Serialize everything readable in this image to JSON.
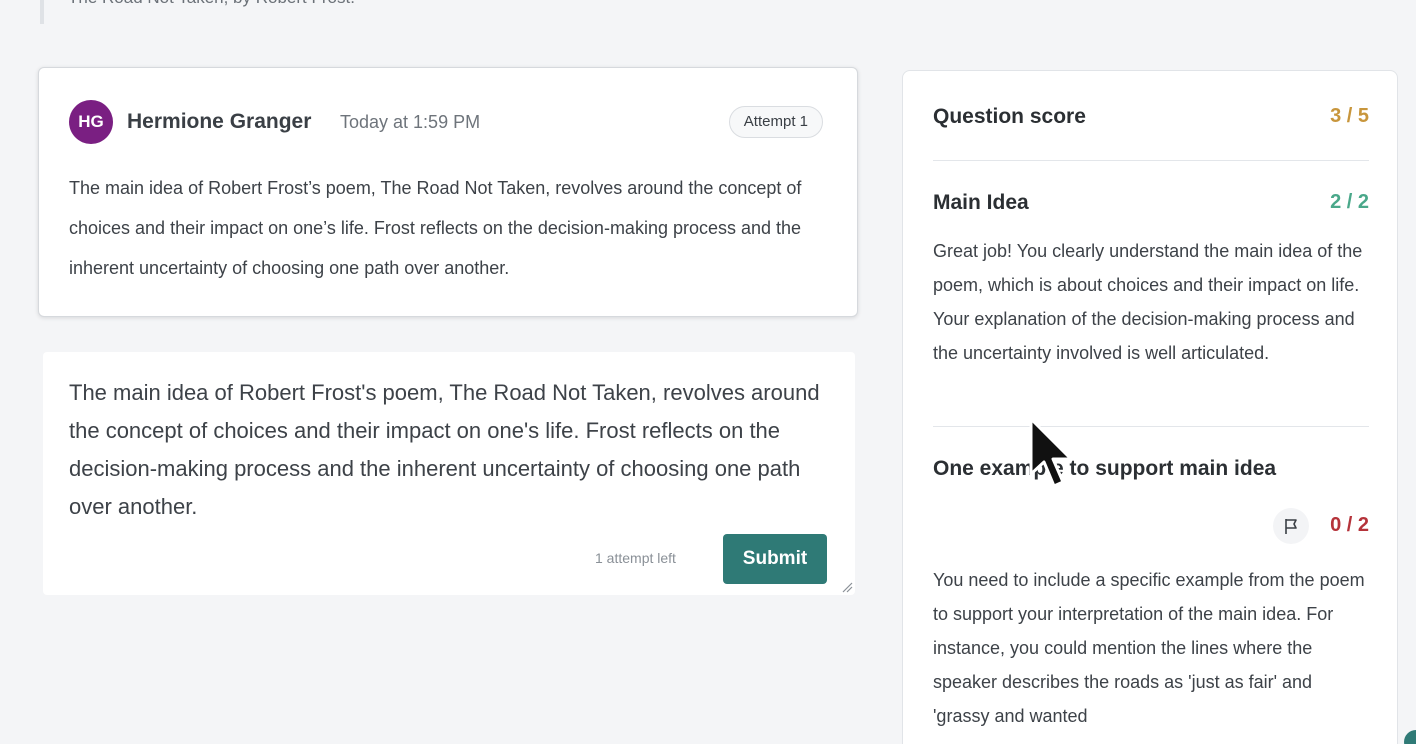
{
  "source": {
    "text": "The Road Not Taken, by Robert Frost."
  },
  "submission": {
    "avatar_initials": "HG",
    "author": "Hermione Granger",
    "timestamp": "Today at 1:59 PM",
    "attempt_badge": "Attempt 1",
    "body": "The main idea of Robert Frost’s poem, The Road Not Taken, revolves around the concept of choices and their impact on one’s life. Frost reflects on the decision-making process and the inherent uncertainty of choosing one path over another."
  },
  "answer": {
    "text": "The main idea of Robert Frost's poem, The Road Not Taken, revolves around the concept of choices and their impact on one's life. Frost reflects on the decision-making process and the inherent uncertainty of choosing one path over another.",
    "attempts_left": "1 attempt left",
    "submit_label": "Submit"
  },
  "score_panel": {
    "question_score_label": "Question score",
    "question_score": "3 / 5",
    "criteria": [
      {
        "title": "Main Idea",
        "score": "2 / 2",
        "feedback": "Great job! You clearly understand the main idea of the poem, which is about choices and their impact on life. Your explanation of the decision-making process and the uncertainty involved is well articulated."
      },
      {
        "title": "One example to support main idea",
        "score": "0 / 2",
        "feedback": "You need to include a specific example from the poem to support your interpretation of the main idea. For instance, you could mention the lines where the speaker describes the roads as 'just as fair' and 'grassy and wanted"
      }
    ]
  },
  "colors": {
    "accent": "#2f7a76",
    "avatar": "#7a1f82",
    "score_partial": "#c8963c",
    "score_full": "#4aa88a",
    "score_zero": "#b5333a"
  },
  "icons": [
    "flag-icon",
    "resize-handle-icon",
    "mouse-cursor"
  ]
}
